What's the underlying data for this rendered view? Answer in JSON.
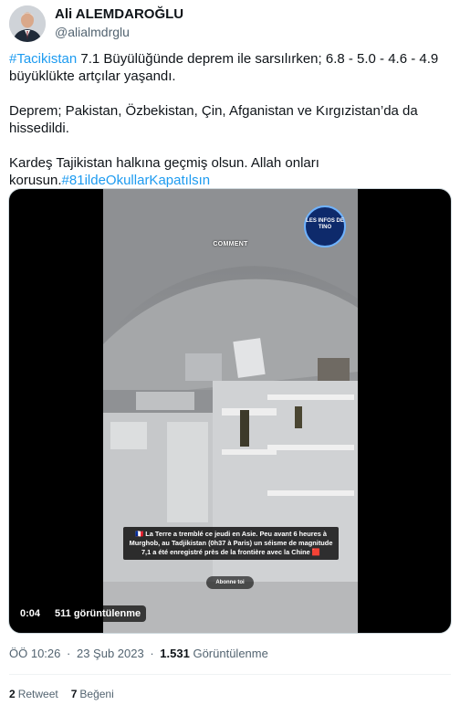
{
  "author": {
    "name": "Ali ALEMDAROĞLU",
    "handle": "@alialmdrglu"
  },
  "tweet": {
    "p1_hashtag": "#Tacikistan",
    "p1_text": " 7.1 Büyülüğünde deprem ile sarsılırken; 6.8 - 5.0 - 4.6 - 4.9 büyüklükte artçılar yaşandı.",
    "p2_text": "Deprem; Pakistan, Özbekistan, Çin, Afganistan ve Kırgızistan’da da hissedildi.",
    "p3_text": "Kardeş Tajikistan halkına geçmiş olsun. Allah onları korusun.",
    "p3_hashtag": "#81ildeOkullarKapatılsın"
  },
  "video": {
    "overlay_comment": "COMMENT",
    "badge_text": "LES INFOS DE TINO",
    "caption": "🇫🇷 La Terre a tremblé ce jeudi en Asie. Peu avant 6 heures à Murghob, au Tadjikistan (0h37 à Paris) un séisme de magnitude 7,1 a été enregistré près de la frontière avec la Chine 🟥",
    "subscribe_label": "Abonne toi",
    "duration": "0:04",
    "views": "511 görüntülenme"
  },
  "meta": {
    "time": "ÖÖ 10:26",
    "separator1": "·",
    "date": "23 Şub 2023",
    "separator2": "·",
    "views_count": "1.531",
    "views_label": " Görüntülenme"
  },
  "stats": {
    "retweets_count": "2",
    "retweets_label": "Retweet",
    "likes_count": "7",
    "likes_label": "Beğeni"
  },
  "colors": {
    "accent": "#1d9bf0",
    "text": "#0f1419",
    "secondary": "#536471"
  }
}
